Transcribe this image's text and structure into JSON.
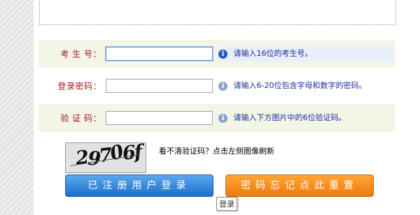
{
  "form": {
    "rows": [
      {
        "label": "考 生 号：",
        "value": "",
        "hint": "请输入16位的考生号。"
      },
      {
        "label": "登录密码：",
        "value": "",
        "hint": "请输入6-20位包含字母和数字的密码。"
      },
      {
        "label": "验 证 码：",
        "value": "",
        "hint": "请输入下方图片中的6位验证码。"
      }
    ],
    "hint_icon_glyph": "i"
  },
  "captcha": {
    "image_text": [
      "2",
      "9",
      "7",
      "0",
      "6",
      "f"
    ],
    "refresh_text": "看不清验证码？点击左侧图像刷新"
  },
  "buttons": {
    "login": "已注册用户登录",
    "reset": "密码忘记点此重置"
  },
  "tooltip": "登录",
  "colors": {
    "label": "#a3161d",
    "hint": "#1c2d9e",
    "login_button": "#2f86dc",
    "reset_button": "#f8901f",
    "row_shade": "#f3f5e6"
  }
}
